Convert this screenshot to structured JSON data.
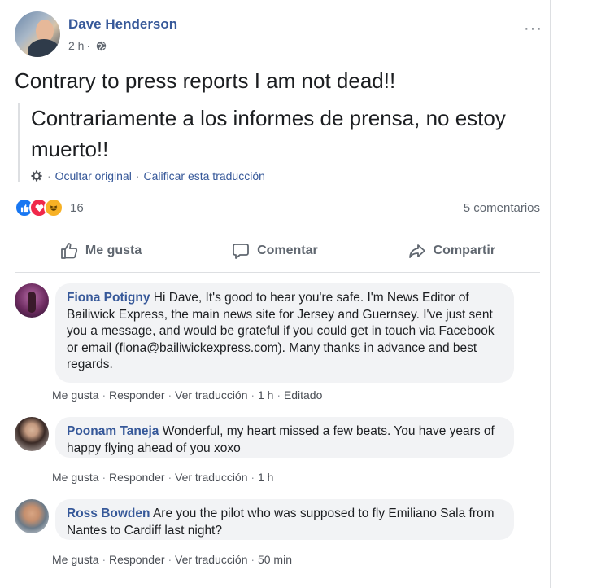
{
  "post": {
    "author": "Dave Henderson",
    "time": "2 h",
    "time_sep": "·",
    "more": "···",
    "text": "Contrary to press reports I am not dead!!",
    "translation": {
      "text": "Contrariamente a los informes de prensa, no estoy muerto!!",
      "hide_original": "Ocultar original",
      "rate": "Calificar esta traducción",
      "sep": "·"
    },
    "reactions_count": "16",
    "comments_count": "5 comentarios",
    "actions": {
      "like": "Me gusta",
      "comment": "Comentar",
      "share": "Compartir"
    }
  },
  "comments": [
    {
      "name": "Fiona Potigny",
      "text": "Hi Dave, It's good to hear you're safe. I'm News Editor of Bailiwick Express, the main news site for Jersey and Guernsey. I've just sent you a message, and would be grateful if you could get in touch via Facebook or email (fiona@bailiwickexpress.com). Many thanks in advance and best regards.",
      "like": "Me gusta",
      "reply": "Responder",
      "translate": "Ver traducción",
      "time": "1 h",
      "edited": "Editado"
    },
    {
      "name": "Poonam Taneja",
      "text": "Wonderful, my heart missed a few beats. You have years of happy flying ahead of you xoxo",
      "like": "Me gusta",
      "reply": "Responder",
      "translate": "Ver traducción",
      "time": "1 h"
    },
    {
      "name": "Ross Bowden",
      "text": "Are you the pilot who was supposed to fly Emiliano Sala from Nantes to Cardiff last night?",
      "like": "Me gusta",
      "reply": "Responder",
      "translate": "Ver traducción",
      "time": "50 min"
    }
  ],
  "ui": {
    "dot": "·"
  },
  "icons": [
    "globe-icon",
    "gear-icon",
    "like-reaction-icon",
    "love-reaction-icon",
    "haha-reaction-icon",
    "thumbs-up-icon",
    "speech-bubble-icon",
    "share-arrow-icon",
    "more-options-icon"
  ],
  "colors": {
    "link": "#365899",
    "bubble": "#f2f3f5",
    "muted": "#606770"
  }
}
